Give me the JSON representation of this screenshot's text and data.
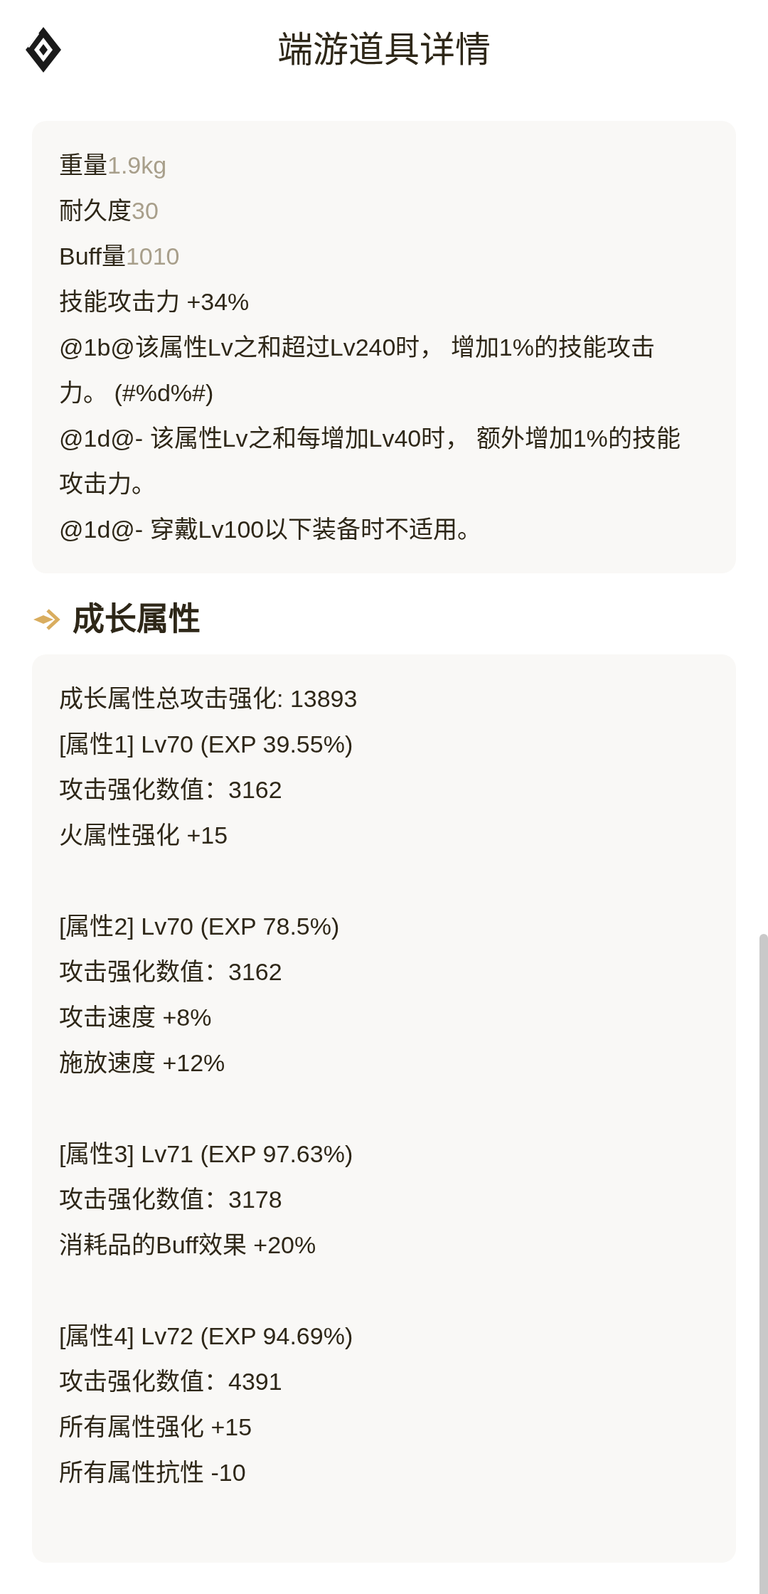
{
  "header": {
    "title": "端游道具详情"
  },
  "basic_card": {
    "lines": [
      {
        "kind": "pair",
        "label": "重量",
        "value": "1.9kg"
      },
      {
        "kind": "pair",
        "label": "耐久度",
        "value": "30"
      },
      {
        "kind": "pair",
        "label": "Buff量",
        "value": "1010"
      },
      {
        "kind": "text",
        "text": "技能攻击力 +34%"
      },
      {
        "kind": "text",
        "text": "@1b@该属性Lv之和超过Lv240时， 增加1%的技能攻击力。 (#%d%#)"
      },
      {
        "kind": "text",
        "text": "@1d@- 该属性Lv之和每增加Lv40时， 额外增加1%的技能攻击力。"
      },
      {
        "kind": "text",
        "text": "@1d@- 穿戴Lv100以下装备时不适用。"
      }
    ]
  },
  "growth_section": {
    "title": "成长属性",
    "summary": "成长属性总攻击强化: 13893",
    "groups": [
      {
        "lines": [
          "[属性1] Lv70 (EXP 39.55%)",
          "攻击强化数值：3162",
          "火属性强化 +15"
        ]
      },
      {
        "lines": [
          "[属性2] Lv70 (EXP 78.5%)",
          "攻击强化数值：3162",
          "攻击速度 +8%",
          "施放速度 +12%"
        ]
      },
      {
        "lines": [
          "[属性3] Lv71 (EXP 97.63%)",
          "攻击强化数值：3178",
          "消耗品的Buff效果 +20%"
        ]
      },
      {
        "lines": [
          "[属性4] Lv72 (EXP 94.69%)",
          "攻击强化数值：4391",
          "所有属性强化 +15",
          "所有属性抗性 -10"
        ]
      }
    ]
  }
}
